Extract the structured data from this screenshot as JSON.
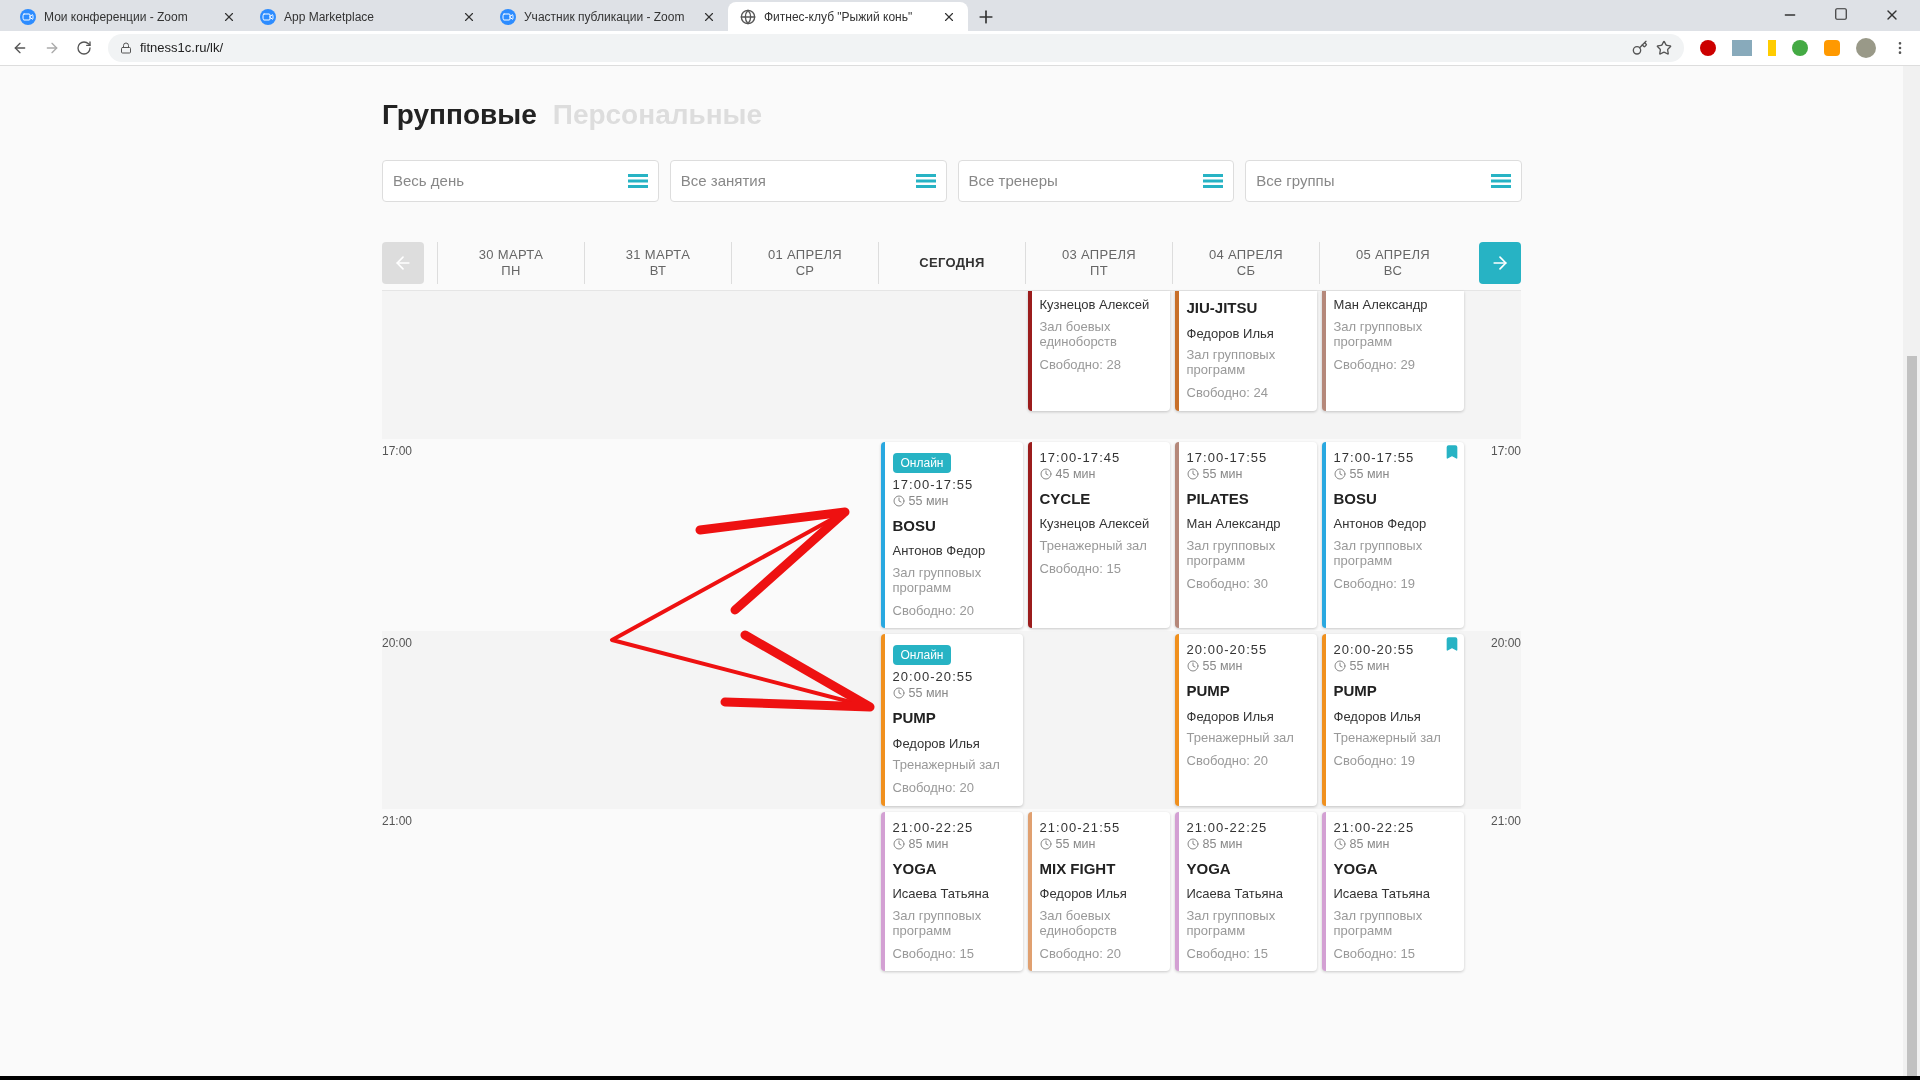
{
  "browser": {
    "tabs": [
      {
        "title": "Мои конференции - Zoom",
        "selected": false
      },
      {
        "title": "App Marketplace",
        "selected": false
      },
      {
        "title": "Участник публикации - Zoom",
        "selected": false
      },
      {
        "title": "Фитнес-клуб \"Рыжий конь\"",
        "selected": true
      }
    ],
    "address": "fitness1c.ru/lk/"
  },
  "schedule_tabs": [
    {
      "label": "Групповые",
      "selected": true
    },
    {
      "label": "Персональные",
      "selected": false
    }
  ],
  "filters": [
    {
      "placeholder": "Весь день"
    },
    {
      "placeholder": "Все занятия"
    },
    {
      "placeholder": "Все тренеры"
    },
    {
      "placeholder": "Все группы"
    }
  ],
  "days": [
    {
      "date": "30 МАРТА",
      "weekday": "ПН",
      "selected": false
    },
    {
      "date": "31 МАРТА",
      "weekday": "ВТ",
      "selected": false
    },
    {
      "date": "01 АПРЕЛЯ",
      "weekday": "СР",
      "selected": false
    },
    {
      "date": "СЕГОДНЯ",
      "selected": true
    },
    {
      "date": "03 АПРЕЛЯ",
      "weekday": "ПТ",
      "selected": false
    },
    {
      "date": "04 АПРЕЛЯ",
      "weekday": "СБ",
      "selected": false
    },
    {
      "date": "05 АПРЕЛЯ",
      "weekday": "ВС",
      "selected": false
    }
  ],
  "rows": [
    {
      "cells": [
        {
          "kind": "empty"
        },
        {
          "kind": "empty"
        },
        {
          "kind": "empty"
        },
        {
          "kind": "empty"
        },
        {
          "kind": "card",
          "color": "#9b1c1c",
          "trainer": "Кузнецов Алексей",
          "room": "Зал боевых единоборств",
          "free": "Свободно: 28",
          "online": false,
          "bookmarked": false
        },
        {
          "kind": "card",
          "color": "#c8702a",
          "title": "JIU-JITSU",
          "trainer": "Федоров Илья",
          "room": "Зал групповых программ",
          "free": "Свободно: 24",
          "online": false,
          "bookmarked": false
        },
        {
          "kind": "card",
          "color": "#b5887a",
          "trainer": "Ман Александр",
          "room": "Зал групповых программ",
          "free": "Свободно: 29",
          "online": false,
          "bookmarked": false
        }
      ]
    },
    {
      "time": "17:00",
      "time_right": "17:00",
      "cells": [
        {
          "kind": "empty"
        },
        {
          "kind": "empty"
        },
        {
          "kind": "empty"
        },
        {
          "kind": "card",
          "color": "#29a8e0",
          "online": true,
          "badge": "Онлайн",
          "time": "17:00-17:55",
          "duration": "55 мин",
          "title": "BOSU",
          "trainer": "Антонов Федор",
          "room": "Зал групповых программ",
          "free": "Свободно: 20",
          "bookmarked": false
        },
        {
          "kind": "card",
          "color": "#9b1c1c",
          "online": false,
          "time": "17:00-17:45",
          "duration": "45 мин",
          "title": "CYCLE",
          "trainer": "Кузнецов Алексей",
          "room": "Тренажерный зал",
          "free": "Свободно: 15",
          "bookmarked": false
        },
        {
          "kind": "card",
          "color": "#b5887a",
          "online": false,
          "time": "17:00-17:55",
          "duration": "55 мин",
          "title": "PILATES",
          "trainer": "Ман Александр",
          "room": "Зал групповых программ",
          "free": "Свободно: 30",
          "bookmarked": false
        },
        {
          "kind": "card",
          "color": "#29a8e0",
          "online": false,
          "time": "17:00-17:55",
          "duration": "55 мин",
          "title": "BOSU",
          "trainer": "Антонов Федор",
          "room": "Зал групповых программ",
          "free": "Свободно: 19",
          "bookmarked": true
        }
      ]
    },
    {
      "time": "20:00",
      "time_right": "20:00",
      "cells": [
        {
          "kind": "empty"
        },
        {
          "kind": "empty"
        },
        {
          "kind": "empty"
        },
        {
          "kind": "card",
          "color": "#f0901e",
          "online": true,
          "badge": "Онлайн",
          "time": "20:00-20:55",
          "duration": "55 мин",
          "title": "PUMP",
          "trainer": "Федоров Илья",
          "room": "Тренажерный зал",
          "free": "Свободно: 20",
          "bookmarked": false
        },
        {
          "kind": "empty"
        },
        {
          "kind": "card",
          "color": "#f0901e",
          "online": false,
          "time": "20:00-20:55",
          "duration": "55 мин",
          "title": "PUMP",
          "trainer": "Федоров Илья",
          "room": "Тренажерный зал",
          "free": "Свободно: 20",
          "bookmarked": false
        },
        {
          "kind": "card",
          "color": "#f0901e",
          "online": false,
          "time": "20:00-20:55",
          "duration": "55 мин",
          "title": "PUMP",
          "trainer": "Федоров Илья",
          "room": "Тренажерный зал",
          "free": "Свободно: 19",
          "bookmarked": true
        }
      ]
    },
    {
      "time": "21:00",
      "time_right": "21:00",
      "cells": [
        {
          "kind": "empty"
        },
        {
          "kind": "empty"
        },
        {
          "kind": "empty"
        },
        {
          "kind": "card",
          "color": "#d3a0d3",
          "online": false,
          "time": "21:00-22:25",
          "duration": "85 мин",
          "title": "YOGA",
          "trainer": "Исаева Татьяна",
          "room": "Зал групповых программ",
          "free": "Свободно: 15",
          "bookmarked": false
        },
        {
          "kind": "card",
          "color": "#e0a070",
          "online": false,
          "time": "21:00-21:55",
          "duration": "55 мин",
          "title": "MIX FIGHT",
          "trainer": "Федоров Илья",
          "room": "Зал боевых единоборств",
          "free": "Свободно: 20",
          "bookmarked": false
        },
        {
          "kind": "card",
          "color": "#d3a0d3",
          "online": false,
          "time": "21:00-22:25",
          "duration": "85 мин",
          "title": "YOGA",
          "trainer": "Исаева Татьяна",
          "room": "Зал групповых программ",
          "free": "Свободно: 15",
          "bookmarked": false
        },
        {
          "kind": "card",
          "color": "#d3a0d3",
          "online": false,
          "time": "21:00-22:25",
          "duration": "85 мин",
          "title": "YOGA",
          "trainer": "Исаева Татьяна",
          "room": "Зал групповых программ",
          "free": "Свободно: 15",
          "bookmarked": false
        }
      ]
    }
  ]
}
